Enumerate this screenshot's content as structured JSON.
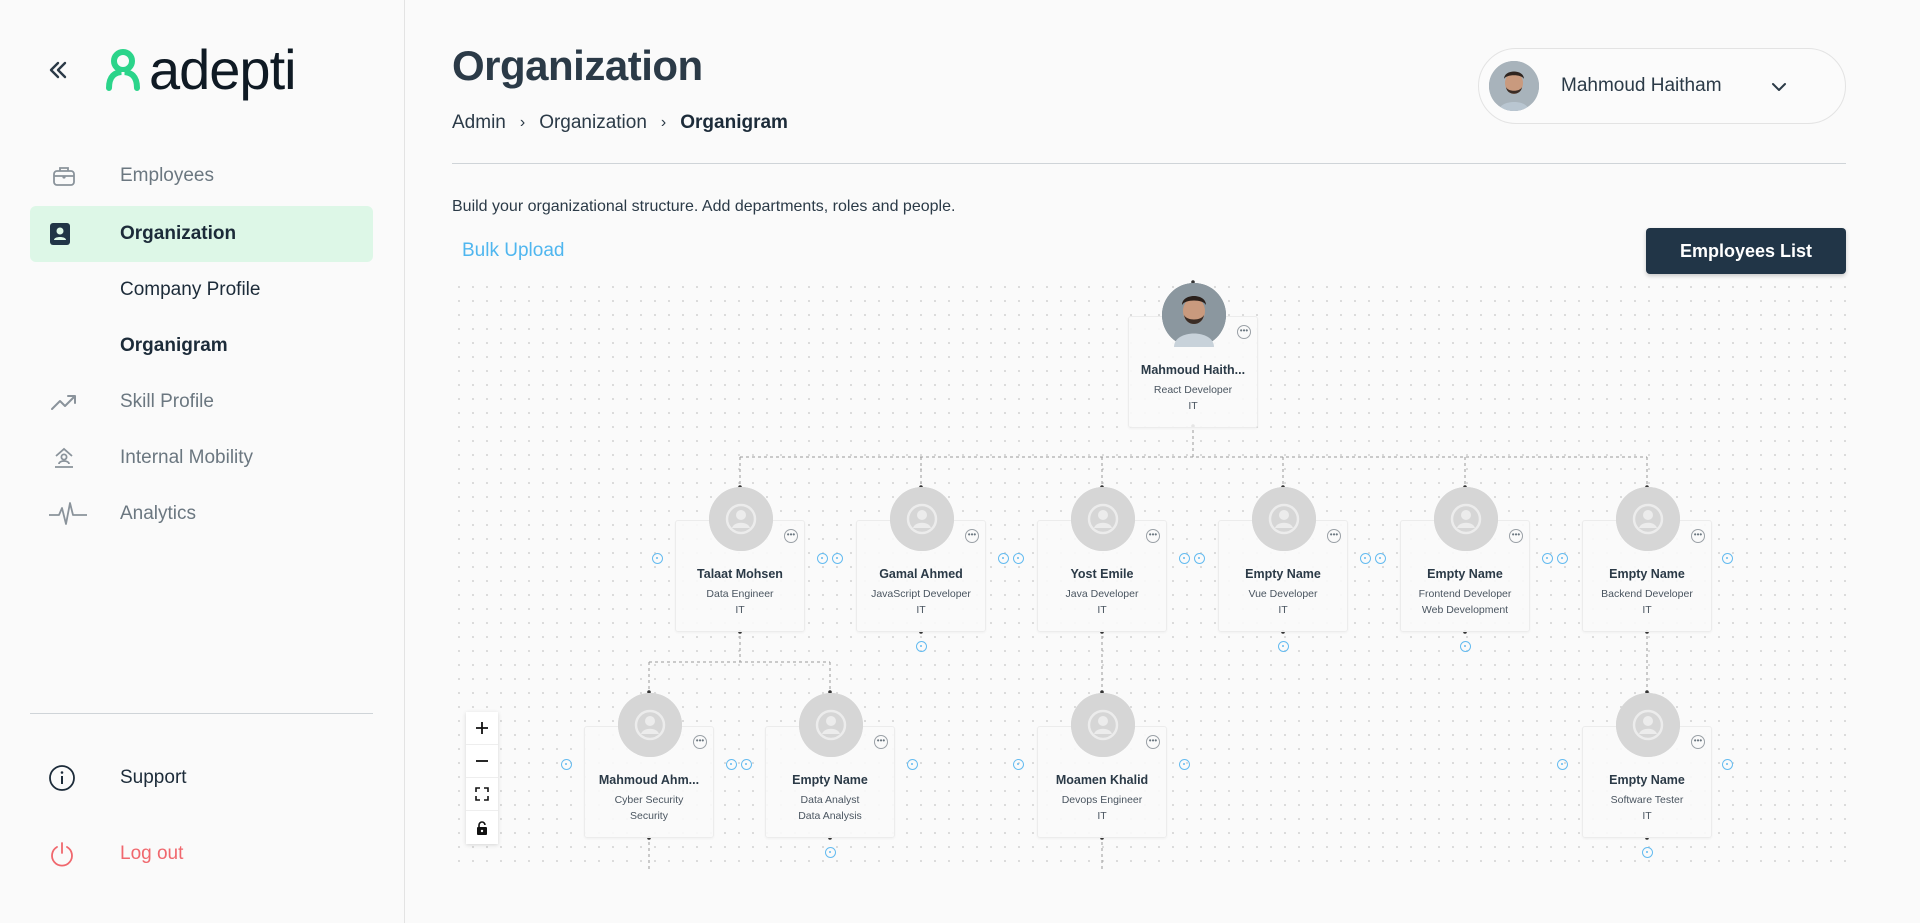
{
  "app": {
    "logo_text": "adepti"
  },
  "sidebar": {
    "items": [
      {
        "label": "Employees"
      },
      {
        "label": "Organization"
      },
      {
        "label": "Company Profile"
      },
      {
        "label": "Organigram"
      },
      {
        "label": "Skill Profile"
      },
      {
        "label": "Internal Mobility"
      },
      {
        "label": "Analytics"
      }
    ],
    "support_label": "Support",
    "logout_label": "Log out"
  },
  "header": {
    "title": "Organization",
    "breadcrumb": [
      "Admin",
      "Organization",
      "Organigram"
    ],
    "user_name": "Mahmoud Haitham"
  },
  "main": {
    "description": "Build your organizational structure. Add departments, roles and people.",
    "bulk_upload_label": "Bulk Upload",
    "employees_list_label": "Employees List"
  },
  "org": {
    "root": {
      "name": "Mahmoud Haith...",
      "role": "React Developer",
      "dept": "IT"
    },
    "level1": [
      {
        "name": "Talaat Mohsen",
        "role": "Data Engineer",
        "dept": "IT"
      },
      {
        "name": "Gamal Ahmed",
        "role": "JavaScript Developer",
        "dept": "IT"
      },
      {
        "name": "Yost Emile",
        "role": "Java Developer",
        "dept": "IT"
      },
      {
        "name": "Empty Name",
        "role": "Vue Developer",
        "dept": "IT"
      },
      {
        "name": "Empty Name",
        "role": "Frontend Developer",
        "dept": "Web Development"
      },
      {
        "name": "Empty Name",
        "role": "Backend Developer",
        "dept": "IT"
      }
    ],
    "level2": [
      {
        "name": "Mahmoud Ahm...",
        "role": "Cyber Security",
        "dept": "Security"
      },
      {
        "name": "Empty Name",
        "role": "Data Analyst",
        "dept": "Data Analysis"
      },
      {
        "name": "Moamen Khalid",
        "role": "Devops Engineer",
        "dept": "IT"
      },
      {
        "name": "Empty Name",
        "role": "Software Tester",
        "dept": "IT"
      }
    ]
  },
  "colors": {
    "accent": "#4fb6ef",
    "active_bg": "#ddf7e7",
    "primary_button": "#213547",
    "logout": "#f0676d",
    "logo_green": "#2bd48a"
  },
  "icons": {
    "collapse": "double-chevron-left-icon",
    "employees": "briefcase-icon",
    "organization": "contact-badge-icon",
    "skill": "trending-up-icon",
    "mobility": "mobility-icon",
    "analytics": "pulse-icon",
    "support": "info-icon",
    "logout": "power-icon",
    "chevron": "chevron-down-icon"
  }
}
